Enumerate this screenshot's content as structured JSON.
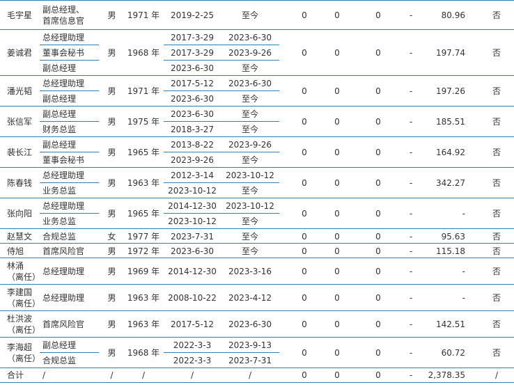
{
  "rows": [
    {
      "name": [
        "毛宇星"
      ],
      "gender": "男",
      "birth": "1971 年",
      "positions": [
        {
          "title": [
            "副总经理、",
            "首席信息官"
          ],
          "start": "2019-2-25",
          "end": "至今"
        }
      ],
      "s1": "0",
      "s2": "0",
      "s3": "0",
      "s4": "-",
      "pay": "80.96",
      "related": "否"
    },
    {
      "name": [
        "姜诚君"
      ],
      "gender": "男",
      "birth": "1968 年",
      "positions": [
        {
          "title": [
            "总经理助理"
          ],
          "start": "2017-3-29",
          "end": "2023-6-30"
        },
        {
          "title": [
            "董事会秘书"
          ],
          "start": "2017-3-29",
          "end": "2023-9-26"
        },
        {
          "title": [
            "副总经理"
          ],
          "start": "2023-6-30",
          "end": "至今"
        }
      ],
      "s1": "0",
      "s2": "0",
      "s3": "0",
      "s4": "-",
      "pay": "197.74",
      "related": "否"
    },
    {
      "name": [
        "潘光韬"
      ],
      "gender": "男",
      "birth": "1971 年",
      "positions": [
        {
          "title": [
            "总经理助理"
          ],
          "start": "2017-5-12",
          "end": "2023-6-30"
        },
        {
          "title": [
            "副总经理"
          ],
          "start": "2023-6-30",
          "end": "至今"
        }
      ],
      "s1": "0",
      "s2": "0",
      "s3": "0",
      "s4": "-",
      "pay": "197.26",
      "related": "否"
    },
    {
      "name": [
        "张信军"
      ],
      "gender": "男",
      "birth": "1975 年",
      "positions": [
        {
          "title": [
            "副总经理"
          ],
          "start": "2023-6-30",
          "end": "至今"
        },
        {
          "title": [
            "财务总监"
          ],
          "start": "2018-3-27",
          "end": "至今"
        }
      ],
      "s1": "0",
      "s2": "0",
      "s3": "0",
      "s4": "-",
      "pay": "185.51",
      "related": "否"
    },
    {
      "name": [
        "裴长江"
      ],
      "gender": "男",
      "birth": "1965 年",
      "positions": [
        {
          "title": [
            "副总经理"
          ],
          "start": "2013-8-22",
          "end": "2023-9-26"
        },
        {
          "title": [
            "董事会秘书"
          ],
          "start": "2023-9-26",
          "end": "至今"
        }
      ],
      "s1": "0",
      "s2": "0",
      "s3": "0",
      "s4": "-",
      "pay": "164.92",
      "related": "否"
    },
    {
      "name": [
        "陈春钱"
      ],
      "gender": "男",
      "birth": "1963 年",
      "positions": [
        {
          "title": [
            "总经理助理"
          ],
          "start": "2012-3-14",
          "end": "2023-10-12"
        },
        {
          "title": [
            "业务总监"
          ],
          "start": "2023-10-12",
          "end": "至今"
        }
      ],
      "s1": "0",
      "s2": "0",
      "s3": "0",
      "s4": "-",
      "pay": "342.27",
      "related": "否"
    },
    {
      "name": [
        "张向阳"
      ],
      "gender": "男",
      "birth": "1965 年",
      "positions": [
        {
          "title": [
            "总经理助理"
          ],
          "start": "2014-12-30",
          "end": "2023-10-12"
        },
        {
          "title": [
            "业务总监"
          ],
          "start": "2023-10-12",
          "end": "至今"
        }
      ],
      "s1": "0",
      "s2": "0",
      "s3": "0",
      "s4": "-",
      "pay": "-",
      "related": "否"
    },
    {
      "name": [
        "赵慧文"
      ],
      "gender": "女",
      "birth": "1977 年",
      "positions": [
        {
          "title": [
            "合规总监"
          ],
          "start": "2023-7-31",
          "end": "至今"
        }
      ],
      "s1": "0",
      "s2": "0",
      "s3": "0",
      "s4": "-",
      "pay": "95.63",
      "related": "否"
    },
    {
      "name": [
        "侍旭"
      ],
      "gender": "男",
      "birth": "1972 年",
      "positions": [
        {
          "title": [
            "首席风险官"
          ],
          "start": "2023-6-30",
          "end": "至今"
        }
      ],
      "s1": "0",
      "s2": "0",
      "s3": "0",
      "s4": "-",
      "pay": "115.18",
      "related": "否"
    },
    {
      "name": [
        "林涌",
        "（离任）"
      ],
      "gender": "男",
      "birth": "1969 年",
      "positions": [
        {
          "title": [
            "总经理助理"
          ],
          "start": "2014-12-30",
          "end": "2023-3-16"
        }
      ],
      "s1": "0",
      "s2": "0",
      "s3": "0",
      "s4": "-",
      "pay": "-",
      "related": "否"
    },
    {
      "name": [
        "李建国",
        "（离任）"
      ],
      "gender": "男",
      "birth": "1963 年",
      "positions": [
        {
          "title": [
            "总经理助理"
          ],
          "start": "2008-10-22",
          "end": "2023-4-12"
        }
      ],
      "s1": "0",
      "s2": "0",
      "s3": "0",
      "s4": "-",
      "pay": "-",
      "related": "否"
    },
    {
      "name": [
        "杜洪波",
        "（离任）"
      ],
      "gender": "男",
      "birth": "1963 年",
      "positions": [
        {
          "title": [
            "首席风险官"
          ],
          "start": "2017-5-12",
          "end": "2023-6-30"
        }
      ],
      "s1": "0",
      "s2": "0",
      "s3": "0",
      "s4": "-",
      "pay": "142.51",
      "related": "否"
    },
    {
      "name": [
        "李海超",
        "（离任）"
      ],
      "gender": "男",
      "birth": "1968 年",
      "positions": [
        {
          "title": [
            "副总经理"
          ],
          "start": "2022-3-3",
          "end": "2023-9-13"
        },
        {
          "title": [
            "合规总监"
          ],
          "start": "2022-3-3",
          "end": "2023-7-31"
        }
      ],
      "s1": "0",
      "s2": "0",
      "s3": "0",
      "s4": "-",
      "pay": "60.72",
      "related": "否"
    }
  ],
  "total": {
    "name": [
      "合计"
    ],
    "gender": "/",
    "birth": "/",
    "positions": [
      {
        "title": [
          "/"
        ],
        "start": "/",
        "end": "/"
      }
    ],
    "s1": "0",
    "s2": "0",
    "s3": "0",
    "s4": "-",
    "pay": "2,378.35",
    "related": "/"
  }
}
